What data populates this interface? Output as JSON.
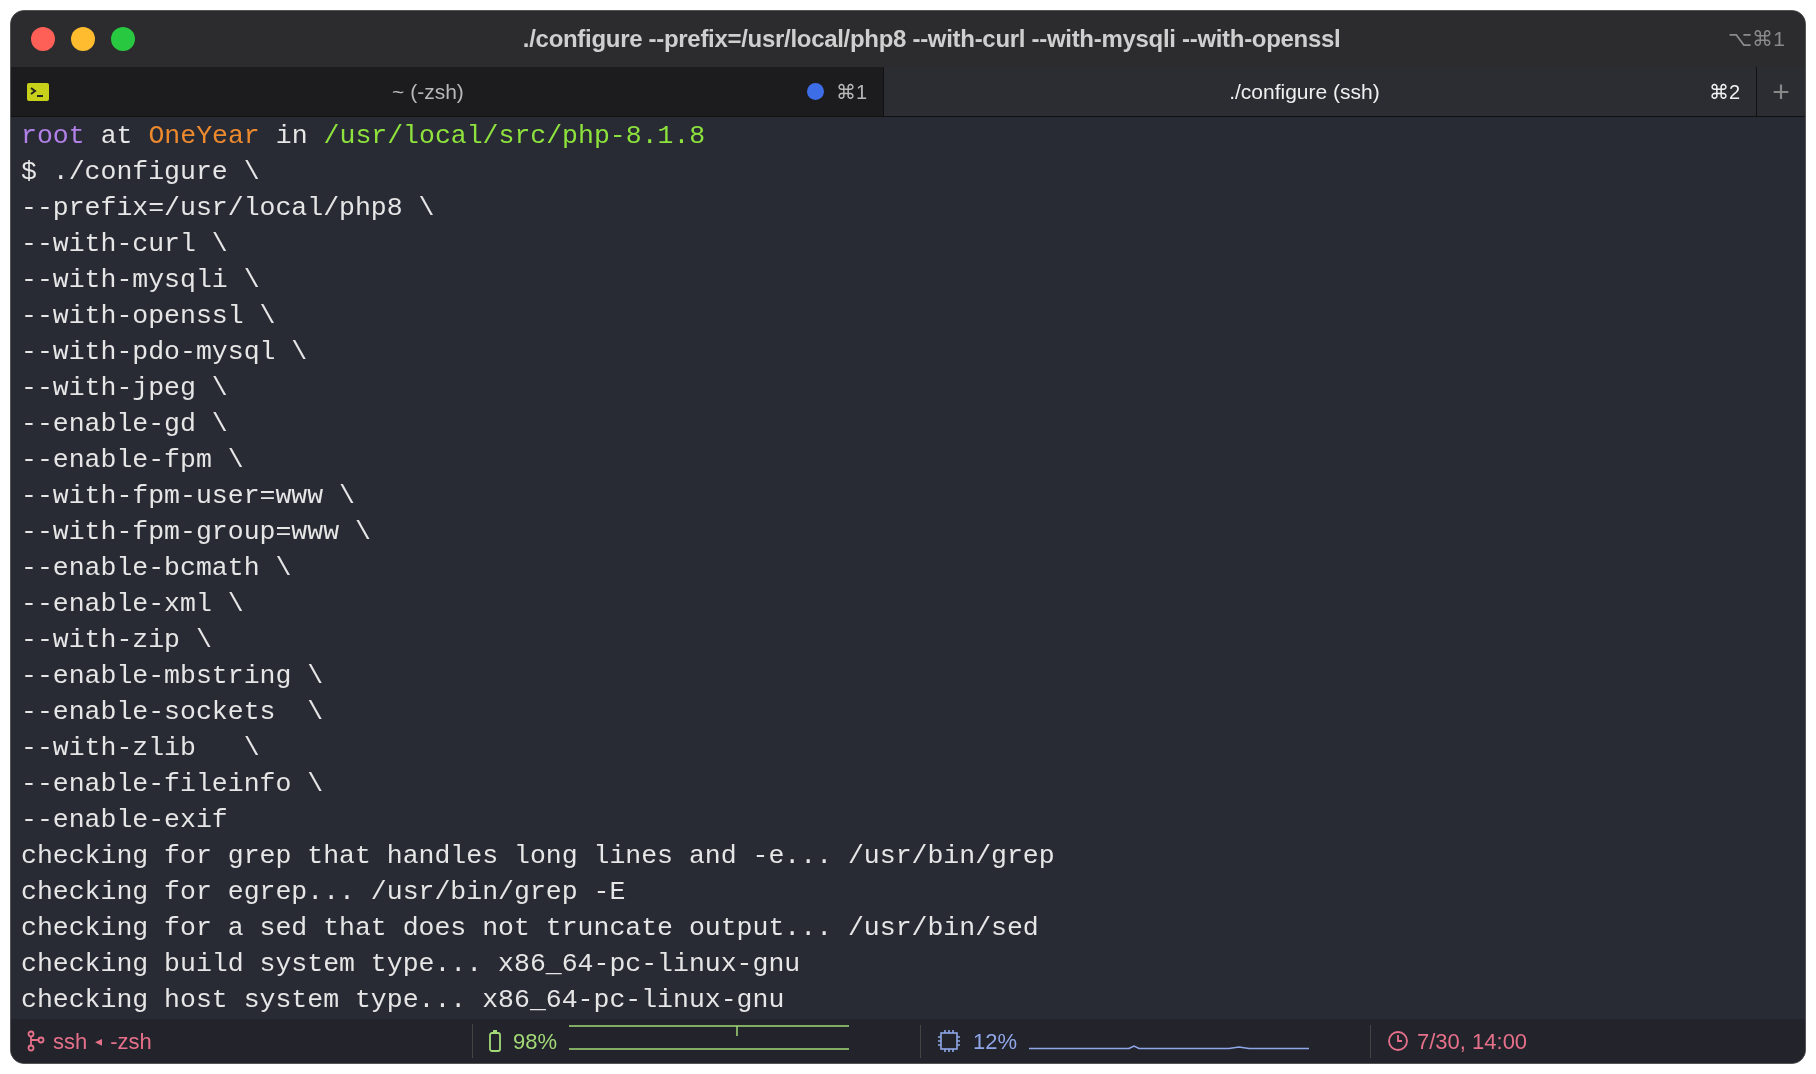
{
  "window": {
    "title": "./configure --prefix=/usr/local/php8 --with-curl --with-mysqli --with-openssl",
    "shortcut": "⌥⌘1"
  },
  "tabs": [
    {
      "label": "~ (-zsh)",
      "shortcut": "⌘1",
      "selected": false,
      "activity": true
    },
    {
      "label": "./configure (ssh)",
      "shortcut": "⌘2",
      "selected": true,
      "activity": false
    }
  ],
  "new_tab": "+",
  "prompt": [
    {
      "kind": "user",
      "text": "root"
    },
    {
      "kind": "plain",
      "text": "at"
    },
    {
      "kind": "host",
      "text": "OneYear"
    },
    {
      "kind": "plain",
      "text": "in"
    },
    {
      "kind": "path",
      "text": "/usr/local/src/php-8.1.8"
    }
  ],
  "lines": [
    "$ ./configure \\",
    "--prefix=/usr/local/php8 \\",
    "--with-curl \\",
    "--with-mysqli \\",
    "--with-openssl \\",
    "--with-pdo-mysql \\",
    "--with-jpeg \\",
    "--enable-gd \\",
    "--enable-fpm \\",
    "--with-fpm-user=www \\",
    "--with-fpm-group=www \\",
    "--enable-bcmath \\",
    "--enable-xml \\",
    "--with-zip \\",
    "--enable-mbstring \\",
    "--enable-sockets  \\",
    "--with-zlib   \\",
    "--enable-fileinfo \\",
    "--enable-exif",
    "checking for grep that handles long lines and -e... /usr/bin/grep",
    "checking for egrep... /usr/bin/grep -E",
    "checking for a sed that does not truncate output... /usr/bin/sed",
    "checking build system type... x86_64-pc-linux-gnu",
    "checking host system type... x86_64-pc-linux-gnu"
  ],
  "status_bar": {
    "job": "ssh",
    "separator": "◂",
    "parent": "-zsh",
    "battery": "98%",
    "cpu": "12%",
    "time": "7/30, 14:00"
  }
}
